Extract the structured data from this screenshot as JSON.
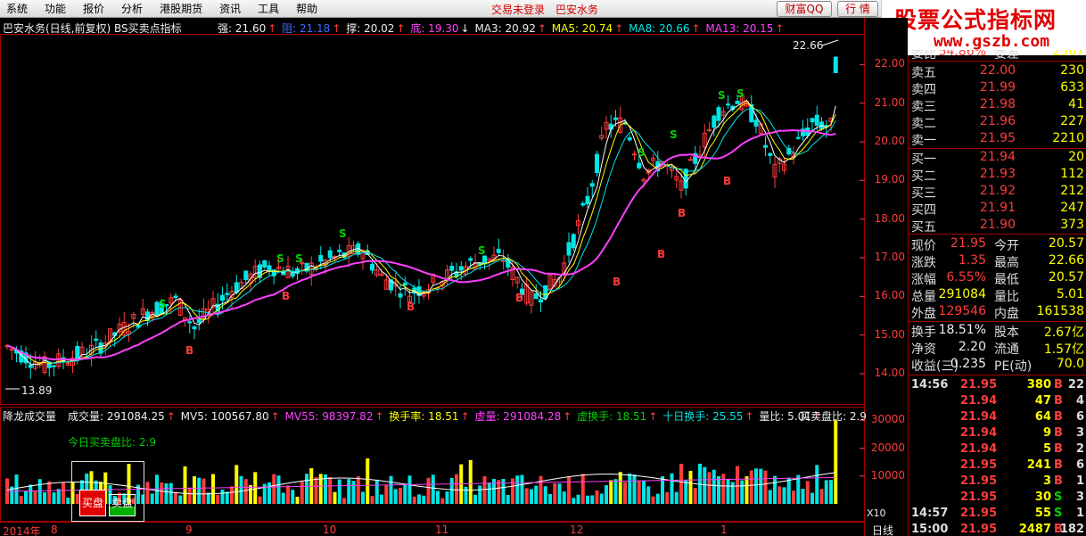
{
  "menu": {
    "items": [
      "系统",
      "功能",
      "报价",
      "分析",
      "港股期货",
      "资讯",
      "工具",
      "帮助"
    ],
    "login_status": "交易未登录",
    "stock_link": "巴安水务",
    "btn_wealth": "财富QQ",
    "btn_quote": "行 情"
  },
  "watermark": {
    "title": "股票公式指标网",
    "url": "www.gszb.com"
  },
  "main_info": {
    "title": "巴安水务(日线,前复权) BS买卖点指标",
    "qiang": "强: 21.60",
    "zu": "阻: 21.18",
    "cheng": "撑: 20.02",
    "di": "底: 19.30",
    "ma3": "MA3: 20.92",
    "ma5": "MA5: 20.74",
    "ma8": "MA8: 20.66",
    "ma13": "MA13: 20.15",
    "high_label": "22.66",
    "low_label": "13.89"
  },
  "price_axis": [
    "22.00",
    "21.00",
    "20.00",
    "19.00",
    "18.00",
    "17.00",
    "16.00",
    "15.00",
    "14.00"
  ],
  "vol_info": {
    "title": "降龙成交量",
    "vol": "成交量: 291084.25",
    "mv5": "MV5: 100567.80",
    "mv55": "MV55: 98397.82",
    "turnover": "换手率: 18.51",
    "xuvol": "虚量: 291084.28",
    "xuturn": "虚换手: 18.51",
    "ten_turn": "十日换手: 25.55",
    "ratio": "量比: 5.01",
    "bs_ratio": "买卖盘比: 2.9",
    "today_bs": "今日买卖盘比: 2.9",
    "buy_label": "买盘",
    "sell_label": "卖盘"
  },
  "vol_axis": [
    "30000",
    "20000",
    "10000"
  ],
  "x10": "X10",
  "dates": [
    "2014年",
    "8",
    "9",
    "10",
    "11",
    "12",
    "1"
  ],
  "period": "日线",
  "orderbook": {
    "partial_top": [
      "委比",
      "54.86%",
      "委差",
      "2367"
    ],
    "asks": [
      {
        "label": "卖五",
        "price": "22.00",
        "vol": "230"
      },
      {
        "label": "卖四",
        "price": "21.99",
        "vol": "633"
      },
      {
        "label": "卖三",
        "price": "21.98",
        "vol": "41"
      },
      {
        "label": "卖二",
        "price": "21.96",
        "vol": "227"
      },
      {
        "label": "卖一",
        "price": "21.95",
        "vol": "2210"
      }
    ],
    "bids": [
      {
        "label": "买一",
        "price": "21.94",
        "vol": "20"
      },
      {
        "label": "买二",
        "price": "21.93",
        "vol": "112"
      },
      {
        "label": "买三",
        "price": "21.92",
        "vol": "212"
      },
      {
        "label": "买四",
        "price": "21.91",
        "vol": "247"
      },
      {
        "label": "买五",
        "price": "21.90",
        "vol": "373"
      }
    ]
  },
  "quote": [
    {
      "l1": "现价",
      "v1": "21.95",
      "c1": "red",
      "l2": "今开",
      "v2": "20.57",
      "c2": "green"
    },
    {
      "l1": "涨跌",
      "v1": "1.35",
      "c1": "red",
      "l2": "最高",
      "v2": "22.66",
      "c2": "red"
    },
    {
      "l1": "涨幅",
      "v1": "6.55%",
      "c1": "red",
      "l2": "最低",
      "v2": "20.57",
      "c2": "green"
    },
    {
      "l1": "总量",
      "v1": "291084",
      "c1": "yellow",
      "l2": "量比",
      "v2": "5.01",
      "c2": "red"
    },
    {
      "l1": "外盘",
      "v1": "129546",
      "c1": "red",
      "l2": "内盘",
      "v2": "161538",
      "c2": "green"
    }
  ],
  "fund": [
    {
      "l1": "换手",
      "v1": "18.51%",
      "l2": "股本",
      "v2": "2.67亿"
    },
    {
      "l1": "净资",
      "v1": "2.20",
      "l2": "流通",
      "v2": "1.57亿"
    },
    {
      "l1": "收益(三)",
      "v1": "0.235",
      "l2": "PE(动)",
      "v2": "70.0"
    }
  ],
  "ticks": [
    {
      "t": "14:56",
      "p": "21.95",
      "v": "380",
      "d": "B",
      "n": "22"
    },
    {
      "t": "",
      "p": "21.94",
      "v": "47",
      "d": "B",
      "n": "4"
    },
    {
      "t": "",
      "p": "21.94",
      "v": "64",
      "d": "B",
      "n": "6"
    },
    {
      "t": "",
      "p": "21.94",
      "v": "9",
      "d": "B",
      "n": "3"
    },
    {
      "t": "",
      "p": "21.94",
      "v": "5",
      "d": "B",
      "n": "2"
    },
    {
      "t": "",
      "p": "21.95",
      "v": "241",
      "d": "B",
      "n": "6"
    },
    {
      "t": "",
      "p": "21.95",
      "v": "3",
      "d": "B",
      "n": "1"
    },
    {
      "t": "",
      "p": "21.95",
      "v": "30",
      "d": "S",
      "n": "3"
    },
    {
      "t": "14:57",
      "p": "21.95",
      "v": "55",
      "d": "S",
      "n": "1"
    },
    {
      "t": "15:00",
      "p": "21.95",
      "v": "2487",
      "d": "B",
      "n": "182"
    }
  ],
  "bs_marks": {
    "s": "S",
    "b": "B"
  },
  "colors": {
    "up": "#ff3b3b",
    "down": "#00e5e5",
    "ma_long": "#ff40ff",
    "panel_border": "#a00000",
    "vol_yellow": "#ffff00"
  }
}
